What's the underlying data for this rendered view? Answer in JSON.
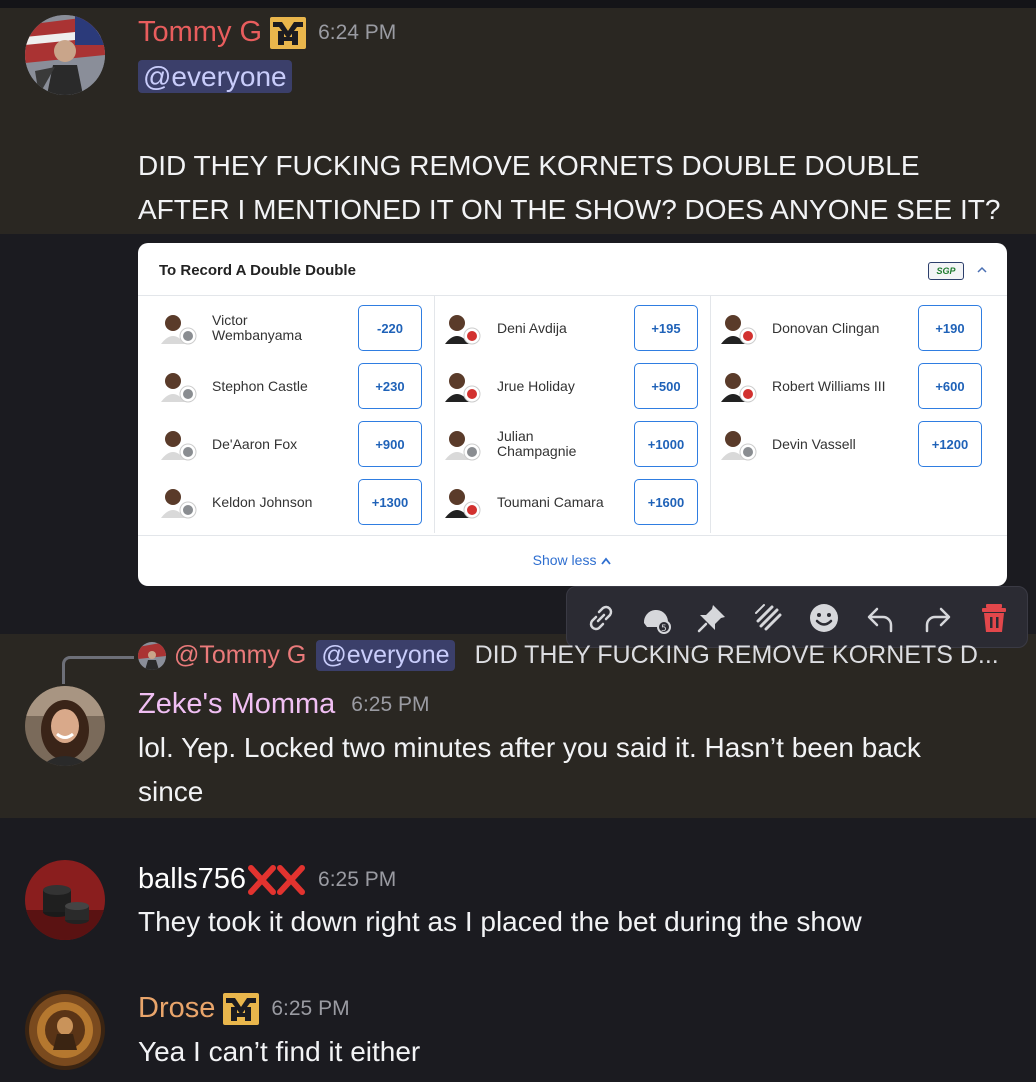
{
  "colors": {
    "background": "#1b1b20",
    "highlight": "#2a2722",
    "tommy": "#e85d5d",
    "zeke": "#f0bff3",
    "balls": "#ffffff",
    "drose": "#e9a56b",
    "mention_bg": "#3b3f6a",
    "mention_fg": "#c9cdfb",
    "odds_blue": "#1f62b8",
    "delete_red": "#e2474b"
  },
  "messages": [
    {
      "author": "Tommy G",
      "time": "6:24 PM",
      "mention": "@everyone",
      "lines": [
        "DID THEY FUCKING REMOVE KORNETS DOUBLE DOUBLE",
        "AFTER I MENTIONED IT ON THE SHOW? DOES ANYONE SEE IT?"
      ]
    },
    {
      "author": "Zeke's Momma",
      "time": "6:25 PM",
      "reply_to": {
        "author": "@Tommy G",
        "mention": "@everyone",
        "preview": "DID THEY FUCKING REMOVE KORNETS D..."
      },
      "lines": [
        "lol. Yep. Locked two minutes after you said it. Hasn’t been back",
        "since"
      ]
    },
    {
      "author": "balls756",
      "time": "6:25 PM",
      "lines": [
        "They took it down right as I placed the bet during the show"
      ]
    },
    {
      "author": "Drose",
      "time": "6:25 PM",
      "lines": [
        "Yea I can’t find it either"
      ]
    }
  ],
  "card": {
    "title": "To Record A Double Double",
    "sgp_label": "SGP",
    "show_less": "Show less",
    "players": [
      {
        "name_1": "Victor",
        "name_2": "Wembanyama",
        "odds": "-220",
        "team": "spurs"
      },
      {
        "name_1": "Deni Avdija",
        "name_2": "",
        "odds": "+195",
        "team": "blazers"
      },
      {
        "name_1": "Donovan Clingan",
        "name_2": "",
        "odds": "+190",
        "team": "blazers"
      },
      {
        "name_1": "Stephon Castle",
        "name_2": "",
        "odds": "+230",
        "team": "spurs"
      },
      {
        "name_1": "Jrue Holiday",
        "name_2": "",
        "odds": "+500",
        "team": "blazers"
      },
      {
        "name_1": "Robert Williams III",
        "name_2": "",
        "odds": "+600",
        "team": "blazers"
      },
      {
        "name_1": "De'Aaron Fox",
        "name_2": "",
        "odds": "+900",
        "team": "spurs"
      },
      {
        "name_1": "Julian",
        "name_2": "Champagnie",
        "odds": "+1000",
        "team": "spurs"
      },
      {
        "name_1": "Devin Vassell",
        "name_2": "",
        "odds": "+1200",
        "team": "spurs"
      },
      {
        "name_1": "Keldon Johnson",
        "name_2": "",
        "odds": "+1300",
        "team": "spurs"
      },
      {
        "name_1": "Toumani Camara",
        "name_2": "",
        "odds": "+1600",
        "team": "blazers"
      }
    ]
  },
  "toolbar": [
    "link-icon",
    "reaction-icon",
    "pin-icon",
    "thread-icon",
    "emoji-icon",
    "reply-icon",
    "forward-icon",
    "delete-icon"
  ]
}
